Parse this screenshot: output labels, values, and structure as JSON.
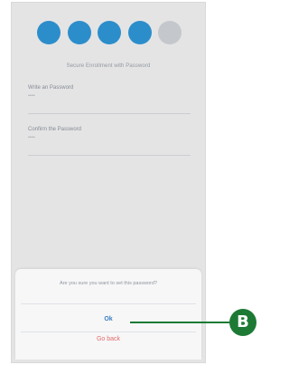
{
  "progress": {
    "steps_total": 5,
    "steps_filled": 4,
    "filled_color": "#2f95d6",
    "empty_color": "#cfd2d6"
  },
  "screen": {
    "subtitle": "Secure Enrollment with Password",
    "fields": [
      {
        "label": "Write an Password",
        "value": "••••"
      },
      {
        "label": "Confirm the Password",
        "value": "••••"
      }
    ]
  },
  "dialog": {
    "message": "Are you sure you want to set this password?",
    "ok_label": "Ok",
    "back_label": "Go back",
    "ok_color": "#3a7fc4",
    "back_color": "#e26b6b"
  },
  "callout": {
    "label": "B",
    "color": "#1d7a34"
  }
}
